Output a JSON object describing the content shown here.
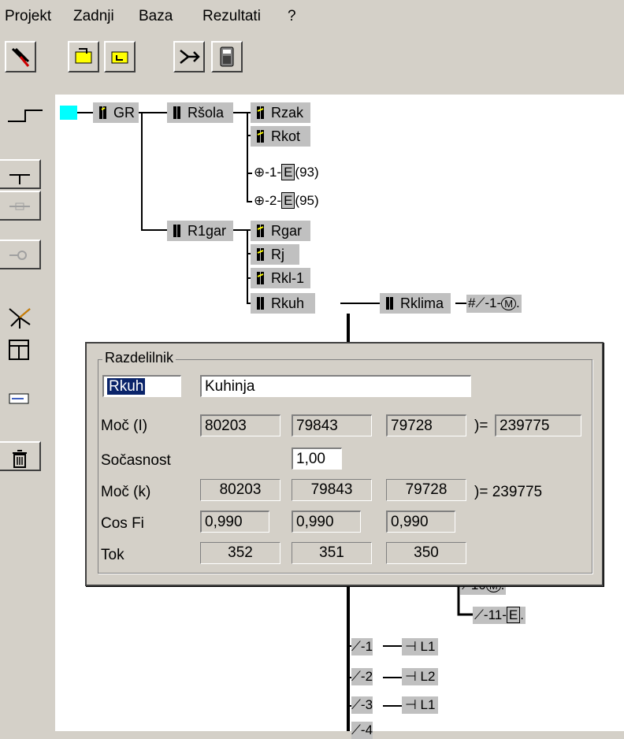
{
  "menu": {
    "items": [
      "Projekt",
      "Zadnji",
      "Baza",
      "Rezultati",
      "?"
    ]
  },
  "toolbar": {
    "buttons": [
      "tool-1-icon",
      "tool-2-icon",
      "tool-3-icon",
      "branch-icon",
      "calculator-icon"
    ]
  },
  "left_tools": [
    "line-tool-icon",
    "tap-icon",
    "fuse-icon",
    "plug-icon",
    "star-icon",
    "layout-icon",
    "window-icon",
    "delete-icon"
  ],
  "tree": {
    "root": "GR",
    "level1": [
      "Ršola",
      "R1gar"
    ],
    "rsola_children": [
      "Rzak",
      "Rkot"
    ],
    "rsola_outputs": [
      {
        "label": "1",
        "value": "(93)"
      },
      {
        "label": "2",
        "value": "(95)"
      }
    ],
    "r1gar_children": [
      "Rgar",
      "Rj",
      "Rkl-1",
      "Rkuh"
    ],
    "rkuh_children": [
      "Rklima"
    ],
    "rklima_outputs": [
      {
        "label": "1"
      },
      {
        "label": "10"
      },
      {
        "label": "11"
      }
    ],
    "rkuh_outputs": [
      {
        "label": "1",
        "load": "L1"
      },
      {
        "label": "2",
        "load": "L2"
      },
      {
        "label": "3",
        "load": "L1"
      },
      {
        "label": "4",
        "load": ""
      }
    ]
  },
  "dialog": {
    "title": "Razdelilnik",
    "code": "Rkuh",
    "name": "Kuhinja",
    "rows": {
      "moc_i": {
        "label": "Moč (I)",
        "values": [
          "80203",
          "79843",
          "79728"
        ],
        "total": "239775"
      },
      "socasnost": {
        "label": "Sočasnost",
        "value": "1,00"
      },
      "moc_k": {
        "label": "Moč (k)",
        "values": [
          "80203",
          "79843",
          "79728"
        ],
        "total": "239775"
      },
      "cos_fi": {
        "label": "Cos Fi",
        "values": [
          "0,990",
          "0,990",
          "0,990"
        ]
      },
      "tok": {
        "label": "Tok",
        "values": [
          "352",
          "351",
          "350"
        ]
      }
    },
    "sum_prefix": ")="
  },
  "colors": {
    "selection": "#00ffff",
    "node_bg": "#c0c0c0",
    "highlight": "#0a246a"
  }
}
